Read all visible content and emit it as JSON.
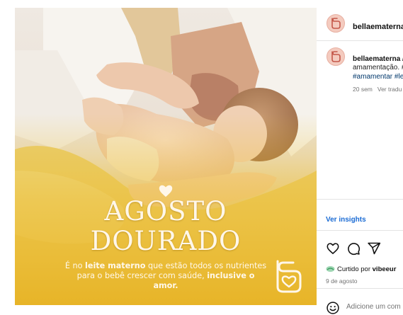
{
  "post": {
    "title_line1": "AGOSTO",
    "title_line2": "DOURADO",
    "caption_part1": "É no ",
    "caption_bold1": "leite materno",
    "caption_part2": " que estão todos os nutrientes para o bebê crescer com saúde, ",
    "caption_bold2": "inclusive o amor.",
    "colors": {
      "gold": "#e9b92b",
      "gold_light": "#f4d56a",
      "cream": "#fff7ea"
    }
  },
  "sidebar": {
    "account_name": "bellaematerna",
    "caption": {
      "username": "bellaematerna /",
      "text": "amamentação. #",
      "hashtags": "#amamentar #le",
      "age": "20 sem",
      "translate": "Ver tradu"
    },
    "insights_label": "Ver insights",
    "liked_prefix": "Curtido por ",
    "liked_user": "vibeeur",
    "date": "9 de agosto",
    "comment_placeholder": "Adicione um com"
  },
  "icons": {
    "like": "heart-outline-icon",
    "comment": "comment-bubble-icon",
    "share": "paper-plane-icon",
    "emoji": "smiley-icon",
    "brand": "bella-materna-logo-icon"
  }
}
